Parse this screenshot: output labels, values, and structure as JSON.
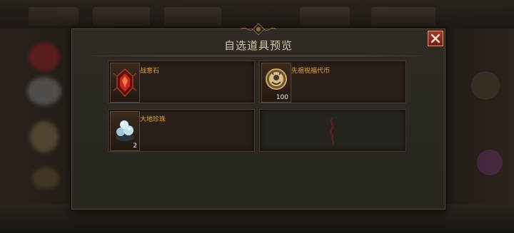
{
  "dialog": {
    "title": "自选道具预览",
    "close_label": "×"
  },
  "items": [
    {
      "name": "战意石",
      "count": "",
      "icon": "red-gem-icon"
    },
    {
      "name": "先祖祝福代币",
      "count": "100",
      "icon": "gold-coin-icon"
    },
    {
      "name": "大地珍珠",
      "count": "2",
      "icon": "pearl-cluster-icon"
    },
    {
      "name": "",
      "count": "",
      "icon": "empty-slot-rune-icon"
    }
  ],
  "colors": {
    "title": "#d8c6a6",
    "item_name": "#e6a33c",
    "close_button": "#a2382b"
  }
}
